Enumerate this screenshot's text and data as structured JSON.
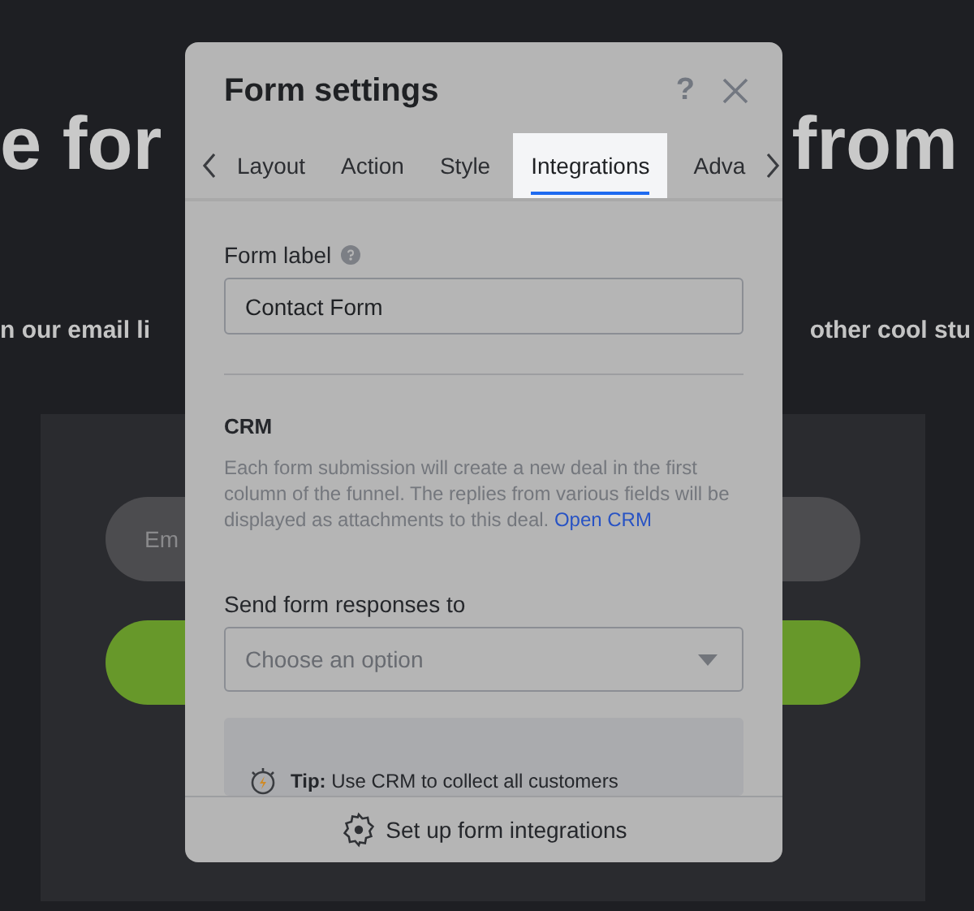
{
  "page": {
    "headline": [
      "e for",
      "from"
    ],
    "subline": [
      "n our email li",
      "other cool stu"
    ],
    "email_placeholder": "Em"
  },
  "dialog": {
    "title": "Form settings",
    "help": "?",
    "tabs": [
      {
        "label": "Layout",
        "selected": false
      },
      {
        "label": "Action",
        "selected": false
      },
      {
        "label": "Style",
        "selected": false
      },
      {
        "label": "Integrations",
        "selected": true
      },
      {
        "label": "Adva",
        "selected": false
      }
    ],
    "form_label": {
      "label": "Form label",
      "value": "Contact Form"
    },
    "crm": {
      "heading": "CRM",
      "description": "Each form submission will create a new deal in the first column of the funnel. The replies from various fields will be displayed as attachments to this deal.",
      "link": "Open CRM"
    },
    "send_to": {
      "label": "Send form responses to",
      "placeholder": "Choose an option"
    },
    "tip": {
      "lead": "Tip:",
      "text": "Use CRM to collect all customers"
    },
    "footer_button": "Set up form integrations"
  }
}
